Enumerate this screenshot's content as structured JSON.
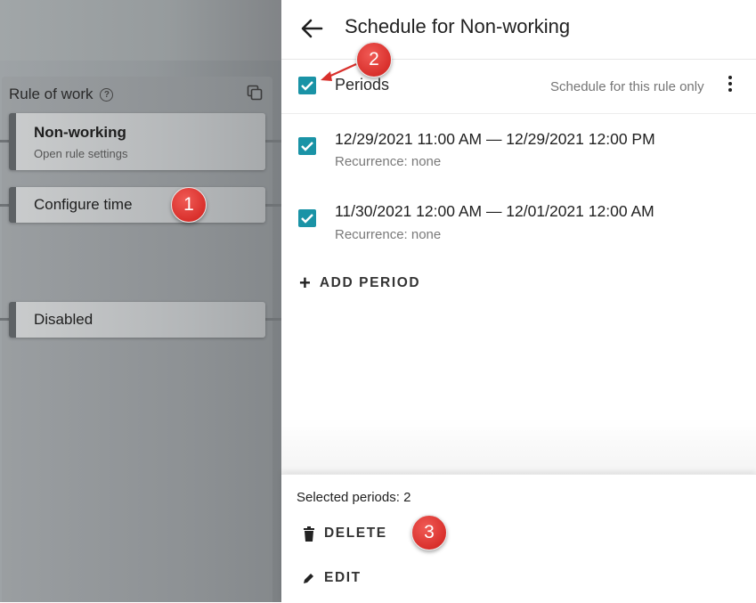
{
  "canvas": {
    "rule_title": "Rule of work",
    "cards": [
      {
        "title": "Non-working",
        "subtitle": "Open rule settings"
      },
      {
        "title": "Configure time"
      },
      {
        "title": "Disabled"
      }
    ]
  },
  "markers": [
    "1",
    "2",
    "3"
  ],
  "sheet": {
    "title": "Schedule for Non-working",
    "periods_label": "Periods",
    "schedule_scope": "Schedule for this rule only",
    "periods": [
      {
        "range": "12/29/2021 11:00 AM — 12/29/2021 12:00 PM",
        "recurrence": "Recurrence: none",
        "checked": true
      },
      {
        "range": "11/30/2021 12:00 AM — 12/01/2021 12:00 AM",
        "recurrence": "Recurrence: none",
        "checked": true
      }
    ],
    "add_period": "ADD PERIOD",
    "selected_periods": "Selected periods: 2",
    "delete_label": "DELETE",
    "edit_label": "EDIT"
  },
  "colors": {
    "checkbox": "#1a93a6",
    "marker": "#d9302c",
    "overlay": "#92979a"
  },
  "icons": [
    "help-icon",
    "copy-icon",
    "back-arrow-icon",
    "more-vert-icon",
    "plus-icon",
    "trash-icon",
    "pencil-icon",
    "checkmark-icon"
  ]
}
